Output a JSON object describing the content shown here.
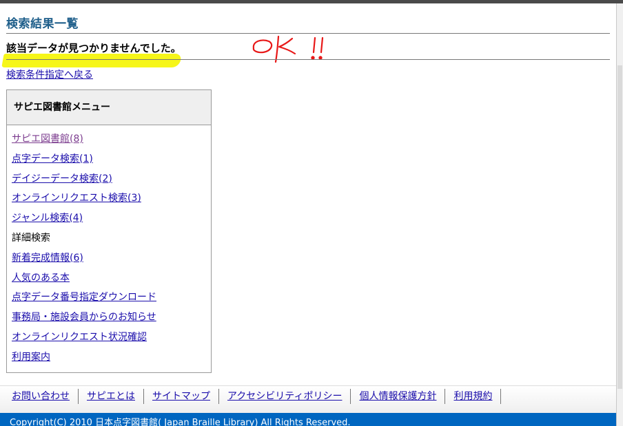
{
  "page": {
    "title": "検索結果一覧",
    "message": "該当データが見つかりませんでした。",
    "annotation": "OK !!",
    "back_link": "検索条件指定へ戻る"
  },
  "menu": {
    "heading": "サピエ図書館メニュー",
    "items": [
      {
        "label": "サピエ図書館(8)",
        "state": "visited"
      },
      {
        "label": "点字データ検索(1)",
        "state": "link"
      },
      {
        "label": "デイジーデータ検索(2)",
        "state": "link"
      },
      {
        "label": "オンラインリクエスト検索(3)",
        "state": "link"
      },
      {
        "label": "ジャンル検索(4)",
        "state": "link"
      },
      {
        "label": "詳細検索",
        "state": "current"
      },
      {
        "label": "新着完成情報(6)",
        "state": "link"
      },
      {
        "label": "人気のある本",
        "state": "link"
      },
      {
        "label": "点字データ番号指定ダウンロード",
        "state": "link"
      },
      {
        "label": "事務局・施設会員からのお知らせ",
        "state": "link"
      },
      {
        "label": "オンラインリクエスト状況確認",
        "state": "link"
      },
      {
        "label": "利用案内",
        "state": "link"
      }
    ]
  },
  "footer": {
    "links": [
      "お問い合わせ",
      "サピエとは",
      "サイトマップ",
      "アクセシビリティポリシー",
      "個人情報保護方針",
      "利用規約"
    ],
    "copyright": "Copyright(C) 2010 日本点字図書館( Japan Braille Library) All Rights Reserved."
  },
  "colors": {
    "title": "#1f5f8b",
    "link": "#1a0dab",
    "visited_link": "#7b3b8e",
    "highlight": "#f5f500",
    "annotation": "#e81818",
    "footer_bar": "#0066c0"
  }
}
